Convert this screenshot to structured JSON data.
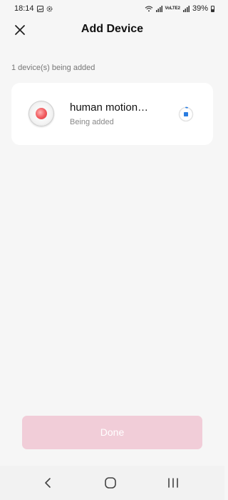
{
  "status_bar": {
    "time": "18:14",
    "network_label": "VoLTE2",
    "battery_percent": "39%",
    "left_icons": [
      "gallery-icon",
      "settings-icon"
    ],
    "right_icons": [
      "wifi-icon",
      "signal-icon",
      "volte-icon",
      "signal-icon",
      "battery-icon"
    ]
  },
  "header": {
    "title": "Add Device",
    "close_icon": "close-icon"
  },
  "section": {
    "label": "1 device(s) being added"
  },
  "device": {
    "name": "human motion…",
    "status": "Being added",
    "icon": "motion-sensor-icon",
    "progress_icon": "progress-spinner-icon"
  },
  "footer": {
    "done_label": "Done"
  },
  "colors": {
    "background": "#f6f6f6",
    "card": "#ffffff",
    "done_disabled": "#f1cdd8",
    "spinner": "#2a7de1"
  },
  "nav": {
    "items": [
      "back-icon",
      "home-icon",
      "recents-icon"
    ]
  }
}
